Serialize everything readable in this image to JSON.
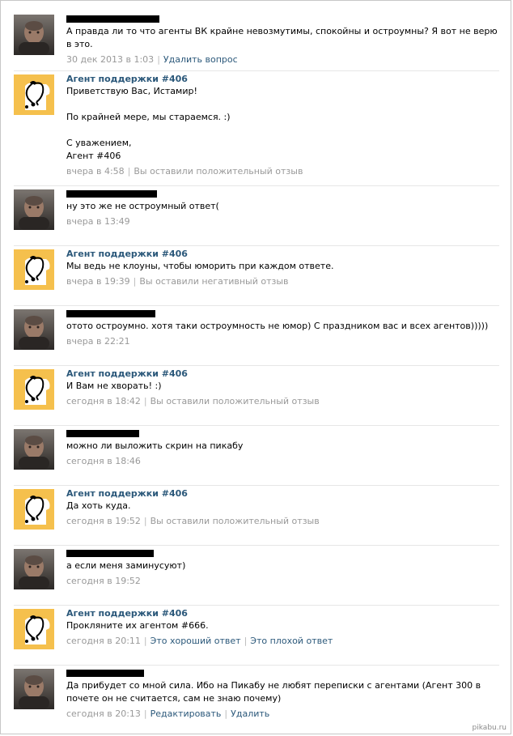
{
  "messages": [
    {
      "type": "user",
      "name": "",
      "text": [
        "А правда ли то что агенты ВК крайне невозмутимы, спокойны и остроумны? Я вот не верю в это."
      ],
      "time": "30 дек 2013 в 1:03",
      "actions": [
        "Удалить вопрос"
      ]
    },
    {
      "type": "agent",
      "name": "Агент поддержки #406",
      "text": [
        "Приветствую Вас, Истамир!",
        "",
        "По крайней мере, мы стараемся. :)",
        "",
        "С уважением,",
        "Агент #406"
      ],
      "time": "вчера в 4:58",
      "status": "Вы оставили положительный отзыв"
    },
    {
      "type": "user",
      "name": "",
      "text": [
        "ну это же не остроумный ответ("
      ],
      "time": "вчера в 13:49"
    },
    {
      "type": "agent",
      "name": "Агент поддержки #406",
      "text": [
        "Мы ведь не клоуны, чтобы юморить при каждом ответе."
      ],
      "time": "вчера в 19:39",
      "status": "Вы оставили негативный отзыв"
    },
    {
      "type": "user",
      "name": "",
      "text": [
        "отото остроумно. хотя таки остроумность не юмор) С праздником вас и всех агентов)))))"
      ],
      "time": "вчера в 22:21"
    },
    {
      "type": "agent",
      "name": "Агент поддержки #406",
      "text": [
        "И Вам не хворать! :)"
      ],
      "time": "сегодня в 18:42",
      "status": "Вы оставили положительный отзыв"
    },
    {
      "type": "user",
      "name": "",
      "text": [
        "можно ли выложить скрин на пикабу"
      ],
      "time": "сегодня в 18:46"
    },
    {
      "type": "agent",
      "name": "Агент поддержки #406",
      "text": [
        "Да хоть куда."
      ],
      "time": "сегодня в 19:52",
      "status": "Вы оставили положительный отзыв"
    },
    {
      "type": "user",
      "name": "",
      "text": [
        "а если меня заминусуют)"
      ],
      "time": "сегодня в 19:52"
    },
    {
      "type": "agent",
      "name": "Агент поддержки #406",
      "text": [
        "Прокляните их агентом #666."
      ],
      "time": "сегодня в 20:11",
      "actions": [
        "Это хороший ответ",
        "Это плохой ответ"
      ]
    },
    {
      "type": "user",
      "name": "",
      "text": [
        "Да прибудет со мной сила. Ибо на Пикабу не любят переписки с агентами (Агент 300 в почете он не считается, сам не знаю почему)"
      ],
      "time": "сегодня в 20:13",
      "actions": [
        "Редактировать",
        "Удалить"
      ]
    }
  ],
  "watermark": "pikabu.ru",
  "colors": {
    "link": "#2b587a",
    "meta": "#999999",
    "agent_avatar": "#f5c04d"
  }
}
